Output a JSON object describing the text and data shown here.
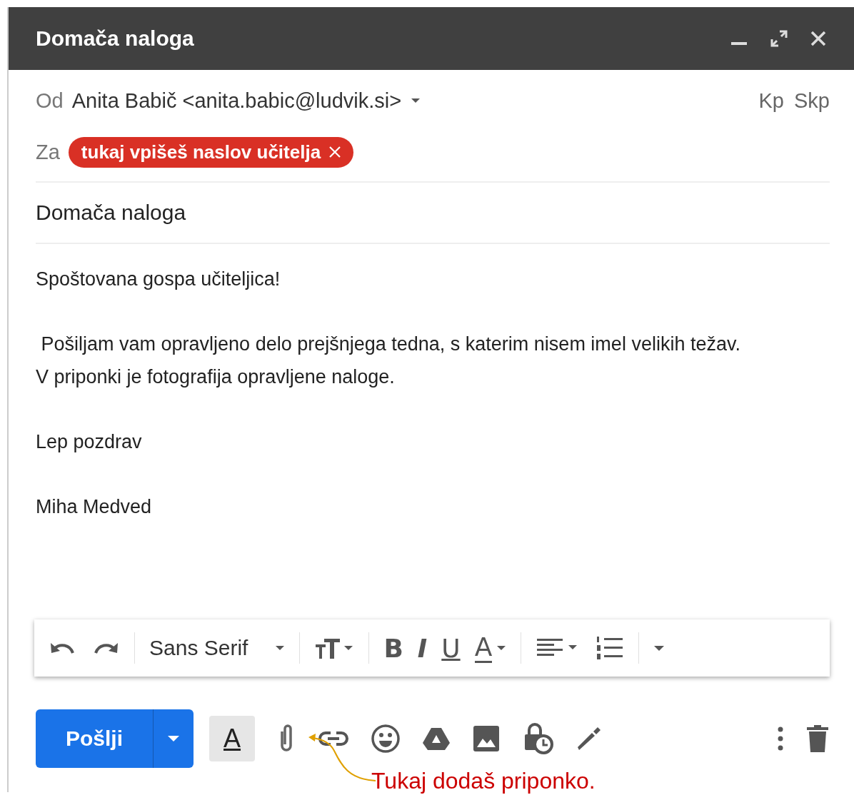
{
  "window": {
    "title": "Domača naloga"
  },
  "from": {
    "label": "Od",
    "value": "Anita Babič <anita.babic@ludvik.si>",
    "cc": "Kp",
    "bcc": "Skp"
  },
  "to": {
    "label": "Za",
    "chips": [
      "tukaj vpišeš naslov učitelja"
    ]
  },
  "subject": "Domača naloga",
  "body": [
    {
      "lines": [
        "Spoštovana gospa učiteljica!"
      ]
    },
    {
      "lines": [
        " Pošiljam vam opravljeno delo prejšnjega tedna, s katerim nisem imel velikih težav.",
        "V priponki je fotografija opravljene naloge."
      ]
    },
    {
      "lines": [
        "Lep pozdrav"
      ]
    },
    {
      "lines": [
        "Miha Medved"
      ]
    }
  ],
  "format_bar": {
    "font": "Sans Serif",
    "bold": "B",
    "italic": "I",
    "underline": "U",
    "text_color": "A"
  },
  "bottom_bar": {
    "send": "Pošlji",
    "formatting": "A"
  },
  "annotation": "Tukaj dodaš priponko."
}
